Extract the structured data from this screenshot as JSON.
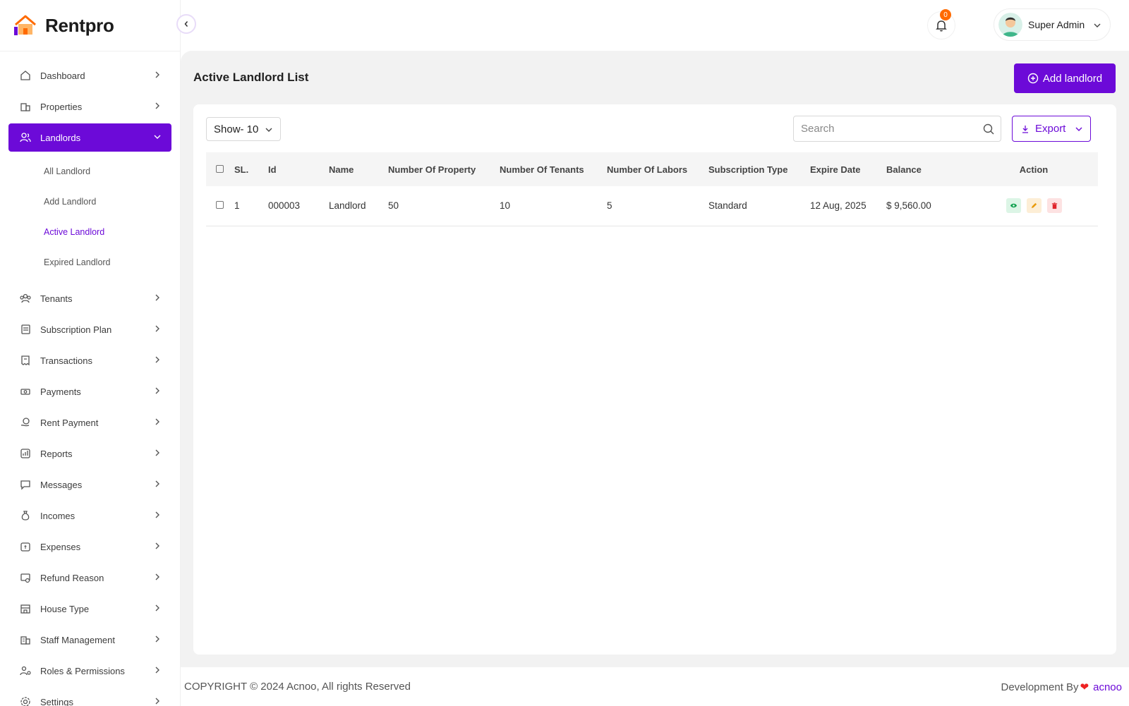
{
  "app": {
    "name": "Rentpro"
  },
  "sidebar": {
    "items": [
      {
        "label": "Dashboard",
        "icon": "home-icon"
      },
      {
        "label": "Properties",
        "icon": "building-icon"
      },
      {
        "label": "Landlords",
        "icon": "users-icon",
        "active": true,
        "children": [
          {
            "label": "All Landlord"
          },
          {
            "label": "Add Landlord"
          },
          {
            "label": "Active Landlord",
            "current": true
          },
          {
            "label": "Expired Landlord"
          }
        ]
      },
      {
        "label": "Tenants",
        "icon": "group-icon"
      },
      {
        "label": "Subscription Plan",
        "icon": "plan-icon"
      },
      {
        "label": "Transactions",
        "icon": "receipt-icon"
      },
      {
        "label": "Payments",
        "icon": "cash-icon"
      },
      {
        "label": "Rent Payment",
        "icon": "coin-hand-icon"
      },
      {
        "label": "Reports",
        "icon": "chart-icon"
      },
      {
        "label": "Messages",
        "icon": "chat-icon"
      },
      {
        "label": "Incomes",
        "icon": "money-bag-icon"
      },
      {
        "label": "Expenses",
        "icon": "wallet-icon"
      },
      {
        "label": "Refund Reason",
        "icon": "refund-icon"
      },
      {
        "label": "House Type",
        "icon": "house-type-icon"
      },
      {
        "label": "Staff Management",
        "icon": "staff-icon"
      },
      {
        "label": "Roles & Permissions",
        "icon": "roles-icon"
      },
      {
        "label": "Settings",
        "icon": "gear-icon"
      }
    ]
  },
  "topbar": {
    "notification_count": "0",
    "user_name": "Super Admin"
  },
  "main": {
    "title": "Active Landlord List",
    "add_button": "Add landlord",
    "show_select": "Show- 10",
    "search_placeholder": "Search",
    "export_button": "Export"
  },
  "table": {
    "headers": [
      "SL.",
      "Id",
      "Name",
      "Number Of Property",
      "Number Of Tenants",
      "Number Of Labors",
      "Subscription Type",
      "Expire Date",
      "Balance",
      "Action"
    ],
    "rows": [
      [
        "1",
        "000003",
        "Landlord",
        "50",
        "10",
        "5",
        "Standard",
        "12 Aug, 2025",
        "$ 9,560.00"
      ]
    ]
  },
  "footer": {
    "copyright": "COPYRIGHT © 2024 Acnoo, All rights Reserved",
    "credit_prefix": "Development By",
    "credit_brand": "acnoo"
  },
  "colors": {
    "accent": "#6c0ad8",
    "badge": "#ff6a00"
  }
}
